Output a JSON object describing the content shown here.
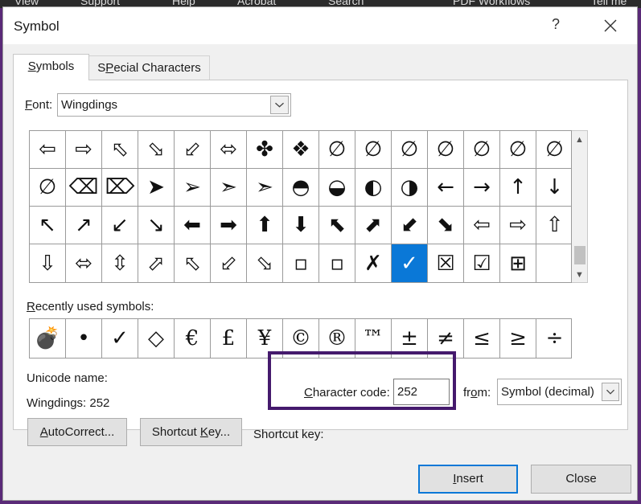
{
  "background_apps": [
    "View",
    "Support",
    "Help",
    "Acrobat",
    "Search",
    "PDF Workflows",
    "Tell me"
  ],
  "dialog": {
    "title": "Symbol",
    "help_glyph": "?",
    "tabs": [
      {
        "label": "Symbols",
        "accel": "S",
        "rest": "ymbols",
        "active": true
      },
      {
        "label": "Special Characters",
        "accel": "P",
        "pre": "S",
        "rest": "ecial Characters",
        "active": false
      }
    ],
    "font": {
      "label": "Font:",
      "accel": "F",
      "rest": "ont:",
      "value": "Wingdings"
    },
    "symbols_rows": [
      [
        "⇦",
        "⇨",
        "⬁",
        "⬂",
        "⬃",
        "⬄",
        "✤",
        "❖",
        "∅",
        "∅",
        "∅",
        "∅",
        "∅",
        "∅",
        "∅"
      ],
      [
        "∅",
        "⌫",
        "⌦",
        "➤",
        "➢",
        "➣",
        "➣",
        "◓",
        "◒",
        "◐",
        "◑",
        "←",
        "→",
        "↑",
        "↓"
      ],
      [
        "↖",
        "↗",
        "↙",
        "↘",
        "⬅",
        "➡",
        "⬆",
        "⬇",
        "⬉",
        "⬈",
        "⬋",
        "⬊",
        "⇦",
        "⇨",
        "⇧"
      ],
      [
        "⇩",
        "⬄",
        "⇳",
        "⬀",
        "⬁",
        "⬃",
        "⬂",
        "▫",
        "▫",
        "✗",
        "✓",
        "☒",
        "☑",
        "⊞",
        ""
      ]
    ],
    "selected_symbol": {
      "row": 3,
      "col": 10
    },
    "recent": {
      "label": "Recently used symbols:",
      "accel": "R",
      "rest": "ecently used symbols:",
      "items": [
        "💣",
        "•",
        "✓",
        "◇",
        "€",
        "£",
        "¥",
        "©",
        "®",
        "™",
        "±",
        "≠",
        "≤",
        "≥",
        "÷"
      ]
    },
    "unicode_name_label": "Unicode name:",
    "unicode_name_value": "Wingdings: 252",
    "autocorrect_button": {
      "label": "AutoCorrect...",
      "accel": "A",
      "rest": "utoCorrect..."
    },
    "shortcut_key_button": {
      "label": "Shortcut Key...",
      "pre": "Shortcut ",
      "accel": "K",
      "rest": "ey..."
    },
    "shortcut_key_label": "Shortcut key:",
    "character_code": {
      "label": "Character code:",
      "accel": "C",
      "rest": "haracter code:",
      "value": "252"
    },
    "from": {
      "label": "from:",
      "pre": "fr",
      "accel": "o",
      "rest": "m:",
      "value": "Symbol (decimal)"
    },
    "insert_button": {
      "label": "Insert",
      "accel": "I",
      "rest": "nsert"
    },
    "close_button": {
      "label": "Close"
    }
  },
  "colors": {
    "selection": "#0a78d7",
    "highlight_box": "#451a6d",
    "outer_bg": "#5a2a78"
  }
}
